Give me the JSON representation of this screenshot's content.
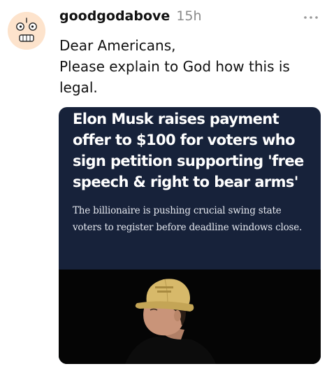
{
  "post": {
    "username": "goodgodabove",
    "timestamp": "15h",
    "text_lines": [
      "Dear Americans,",
      "Please explain to God how this is",
      "legal."
    ]
  },
  "icons": {
    "more": "more-dots-icon",
    "avatar": "cartoon-face-avatar"
  },
  "card": {
    "headline_lines": [
      "Elon Musk raises payment",
      "offer to $100 for voters who",
      "sign petition supporting 'free",
      "speech & right to bear arms'"
    ],
    "subhead_lines": [
      "The billionaire is pushing crucial swing state",
      "voters to register before deadline windows close."
    ],
    "photo_description_icon": "news-photo"
  },
  "colors": {
    "card_background": "#17223a",
    "headline_text": "#ffffff",
    "timestamp_text": "#8a8a8a",
    "photo_background": "#050505",
    "cap": "#d7b96a"
  }
}
